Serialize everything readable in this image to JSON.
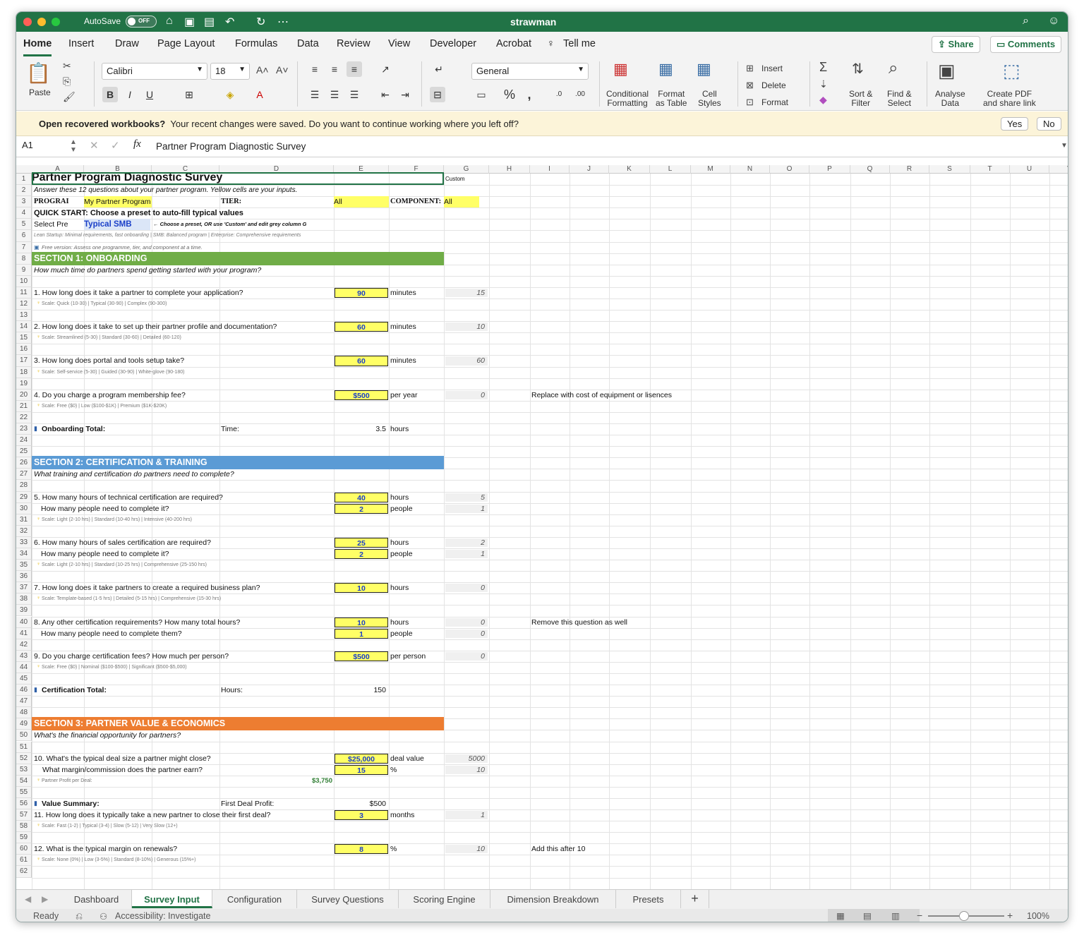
{
  "window": {
    "autosave_label": "AutoSave",
    "autosave_state": "OFF",
    "title": "strawman"
  },
  "ribbon_tabs": [
    "Home",
    "Insert",
    "Draw",
    "Page Layout",
    "Formulas",
    "Data",
    "Review",
    "View",
    "Developer",
    "Acrobat"
  ],
  "tell_me": "Tell me",
  "share_label": "Share",
  "comments_label": "Comments",
  "ribbon": {
    "paste": "Paste",
    "font_name": "Calibri",
    "font_size": "18",
    "number_format": "General",
    "conditional_formatting": [
      "Conditional",
      "Formatting"
    ],
    "format_as_table": [
      "Format",
      "as Table"
    ],
    "cell_styles": [
      "Cell",
      "Styles"
    ],
    "insert": "Insert",
    "delete": "Delete",
    "format": "Format",
    "sort_filter": [
      "Sort &",
      "Filter"
    ],
    "find_select": [
      "Find &",
      "Select"
    ],
    "analyse_data": [
      "Analyse",
      "Data"
    ],
    "create_pdf": [
      "Create PDF",
      "and share link"
    ]
  },
  "notify": {
    "bold": "Open recovered workbooks?",
    "text": "Your recent changes were saved. Do you want to continue working where you left off?",
    "yes": "Yes",
    "no": "No"
  },
  "formula_bar": {
    "name_box": "A1",
    "content": "Partner Program Diagnostic Survey"
  },
  "columns": [
    "A",
    "B",
    "C",
    "D",
    "E",
    "F",
    "G",
    "H",
    "I",
    "J",
    "K",
    "L",
    "M",
    "N",
    "O",
    "P",
    "Q",
    "R",
    "S",
    "T",
    "U",
    "V"
  ],
  "sheet": {
    "title": "Partner Program Diagnostic Survey",
    "custom": "Custom",
    "r2": "Answer these 12 questions about your partner program. Yellow cells are your inputs.",
    "r3_prog": "PROGRAI",
    "r3_prog_val": "My Partner Program",
    "r3_tier": "TIER:",
    "r3_tier_val": "All",
    "r3_comp": "COMPONENT:",
    "r3_comp_val": "All",
    "r4": "QUICK START: Choose a preset to auto-fill typical values",
    "r5_label": "Select Pre",
    "r5_val": "Typical SMB",
    "r5_note": "← Choose a preset, OR use 'Custom' and edit grey column G",
    "r6": "Lean Startup: Minimal requirements, fast onboarding | SMB: Balanced program | Enterprise: Comprehensive requirements",
    "r7": "Free version: Assess one programme, tier, and component at a time.",
    "s1": "SECTION 1: ONBOARDING",
    "s1_sub": "How much time do partners spend getting started with your program?",
    "q1": "1. How long does it take a partner to complete your application?",
    "q1_v": "90",
    "q1_u": "minutes",
    "q1_g": "15",
    "q1_s": "Scale: Quick (10-30) | Typical (30-90) | Complex (90-300)",
    "q2": "2. How long does it take to set up their partner profile and documentation?",
    "q2_v": "60",
    "q2_u": "minutes",
    "q2_g": "10",
    "q2_s": "Scale: Streamlined (5-30) | Standard (30-60) | Detailed (60-120)",
    "q3": "3. How long does portal and tools setup take?",
    "q3_v": "60",
    "q3_u": "minutes",
    "q3_g": "60",
    "q3_s": "Scale: Self-service (5-30) | Guided (30-90) | White-glove (90-180)",
    "q4": "4. Do you charge a program membership fee?",
    "q4_v": "$500",
    "q4_u": "per year",
    "q4_g": "0",
    "q4_note": "Replace with cost of equipment or lisences",
    "q4_s": "Scale: Free ($0) | Low ($100-$1K) | Premium ($1K-$20K)",
    "ob_total": "Onboarding Total:",
    "ob_time": "Time:",
    "ob_val": "3.5",
    "ob_unit": "hours",
    "s2": "SECTION 2: CERTIFICATION & TRAINING",
    "s2_sub": "What training and certification do partners need to complete?",
    "q5": "5. How many hours of technical certification are required?",
    "q5_v": "40",
    "q5_u": "hours",
    "q5_g": "5",
    "q5b": "How many people need to complete it?",
    "q5b_v": "2",
    "q5b_u": "people",
    "q5b_g": "1",
    "q5_s": "Scale: Light (2-10 hrs) | Standard (10-40 hrs) | Intensive (40-200 hrs)",
    "q6": "6. How many hours of sales certification are required?",
    "q6_v": "25",
    "q6_u": "hours",
    "q6_g": "2",
    "q6b": "How many people need to complete it?",
    "q6b_v": "2",
    "q6b_u": "people",
    "q6b_g": "1",
    "q6_s": "Scale: Light (2-10 hrs) | Standard (10-25 hrs) | Comprehensive (25-150 hrs)",
    "q7": "7. How long does it take partners to create a required business plan?",
    "q7_v": "10",
    "q7_u": "hours",
    "q7_g": "0",
    "q7_s": "Scale: Template-based (1-5 hrs) | Detailed (5-15 hrs) | Comprehensive (15-30 hrs)",
    "q8": "8. Any other certification requirements? How many total hours?",
    "q8_v": "10",
    "q8_u": "hours",
    "q8_g": "0",
    "q8_note": "Remove this question as well",
    "q8b": "How many people need to complete them?",
    "q8b_v": "1",
    "q8b_u": "people",
    "q8b_g": "0",
    "q9": "9. Do you charge certification fees? How much per person?",
    "q9_v": "$500",
    "q9_u": "per person",
    "q9_g": "0",
    "q9_s": "Scale: Free ($0) | Nominal ($100-$500) | Significant ($500-$5,000)",
    "ct_total": "Certification Total:",
    "ct_hours": "Hours:",
    "ct_val": "150",
    "s3": "SECTION 3: PARTNER VALUE & ECONOMICS",
    "s3_sub": "What's the financial opportunity for partners?",
    "q10": "10. What's the typical deal size a partner might close?",
    "q10_v": "$25,000",
    "q10_u": "deal value",
    "q10_g": "5000",
    "q10b": "What margin/commission does the partner earn?",
    "q10b_v": "15",
    "q10b_u": "%",
    "q10b_g": "10",
    "q10_s": "Partner Profit per Deal:",
    "q10_profit": "$3,750",
    "vs": "Value Summary:",
    "vs_label": "First Deal Profit:",
    "vs_val": "$500",
    "q11": "11. How long does it typically take a new partner to close their first deal?",
    "q11_v": "3",
    "q11_u": "months",
    "q11_g": "1",
    "q11_s": "Scale: Fast (1-2) | Typical (3-4) | Slow (5-12) | Very Slow (12+)",
    "q12": "12. What is the typical margin on renewals?",
    "q12_v": "8",
    "q12_u": "%",
    "q12_g": "10",
    "q12_note": "Add this after 10",
    "q12_s": "Scale: None (0%) | Low (3-5%) | Standard (8-10%) | Generous (15%+)"
  },
  "sheet_tabs": [
    "Dashboard",
    "Survey Input",
    "Configuration",
    "Survey Questions",
    "Scoring Engine",
    "Dimension Breakdown",
    "Presets"
  ],
  "status": {
    "ready": "Ready",
    "accessibility": "Accessibility: Investigate",
    "zoom": "100%"
  },
  "colors": {
    "excel_green": "#217346",
    "section1": "#70ad47",
    "section2": "#5b9bd5",
    "section3": "#ed7d31",
    "input_yellow": "#ffff66"
  }
}
